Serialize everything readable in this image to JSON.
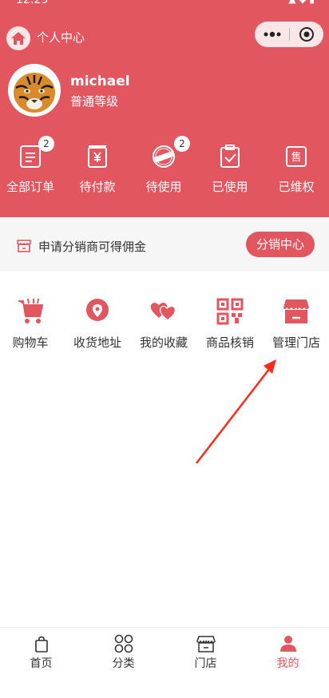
{
  "status_bar": {
    "time": "12:29",
    "icons": "signal wifi battery"
  },
  "nav": {
    "title": "个人中心",
    "home_icon": "home-icon",
    "more_icon": "more-dots-icon",
    "target_icon": "record-icon"
  },
  "user": {
    "name": "michael",
    "level": "普通等级",
    "avatar": "tiger-avatar"
  },
  "orders": [
    {
      "label": "全部订单",
      "badge": "2"
    },
    {
      "label": "待付款"
    },
    {
      "label": "待使用",
      "badge": "2"
    },
    {
      "label": "已使用"
    },
    {
      "label": "已维权"
    }
  ],
  "promo": {
    "text": "申请分销商可得佣金",
    "button": "分销中心"
  },
  "tools": [
    {
      "label": "购物车"
    },
    {
      "label": "收货地址"
    },
    {
      "label": "我的收藏"
    },
    {
      "label": "商品核销"
    },
    {
      "label": "管理门店"
    }
  ],
  "tabs": [
    {
      "label": "首页"
    },
    {
      "label": "分类"
    },
    {
      "label": "门店"
    },
    {
      "label": "我的"
    }
  ],
  "colors": {
    "accent": "#e2565f",
    "promo_bg": "#f6f6f6",
    "tab_active": "#e2565f"
  }
}
